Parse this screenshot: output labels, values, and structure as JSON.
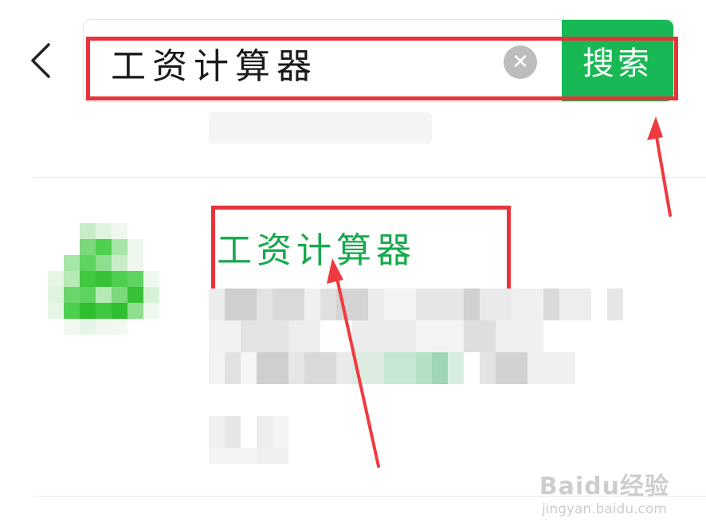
{
  "header": {
    "back_icon": "chevron-left-icon",
    "back_glyph": "‹",
    "search": {
      "value": "工资计算器",
      "clear_glyph": "✕",
      "submit_label": "搜索"
    }
  },
  "results": [
    {
      "title": "工资计算器"
    }
  ],
  "colors": {
    "accent_green": "#18b955",
    "highlight_red": "#e8333a",
    "arrow_red": "#ef3a3f"
  },
  "watermark": {
    "logo": "Baidu经验",
    "site": "jingyan.baidu.com"
  }
}
